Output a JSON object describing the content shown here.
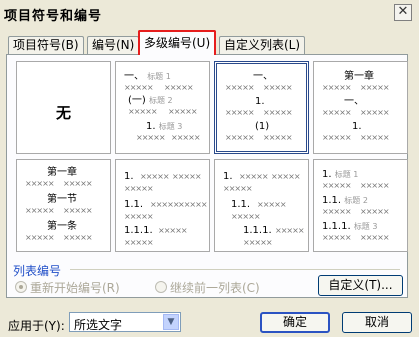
{
  "window": {
    "title": "项目符号和编号",
    "close_glyph": "✕"
  },
  "tabs": [
    {
      "label": "项目符号(B)"
    },
    {
      "label": "编号(N)"
    },
    {
      "label": "多级编号(U)"
    },
    {
      "label": "自定义列表(L)"
    }
  ],
  "active_tab": 2,
  "gallery": {
    "selected_index": 2,
    "x_chars": "×××××",
    "cells": [
      {
        "none_label": "无"
      },
      {
        "lines": [
          {
            "text": "一、",
            "sub": "标题 1"
          },
          {
            "text": "(一)",
            "sub": "标题 2"
          },
          {
            "text": "1.",
            "sub": "标题 3"
          }
        ]
      },
      {
        "lines": [
          {
            "text": "一、"
          },
          {
            "text": "1."
          },
          {
            "text": "(1)"
          }
        ]
      },
      {
        "lines": [
          {
            "text": "第一章"
          },
          {
            "text": "一、"
          },
          {
            "text": "1."
          }
        ]
      },
      {
        "lines": [
          {
            "text": "第一章"
          },
          {
            "text": "第一节"
          },
          {
            "text": "第一条"
          }
        ]
      },
      {
        "lines": [
          {
            "text": "1."
          },
          {
            "text": "1.1."
          },
          {
            "text": "1.1.1."
          }
        ]
      },
      {
        "lines": [
          {
            "text": "1."
          },
          {
            "text": "1.1."
          },
          {
            "text": "1.1.1."
          }
        ]
      },
      {
        "lines": [
          {
            "text": "1.",
            "sub": "标题 1"
          },
          {
            "text": "1.1.",
            "sub": "标题 2"
          },
          {
            "text": "1.1.1.",
            "sub": "标题 3"
          }
        ]
      }
    ]
  },
  "list_numbering": {
    "title": "列表编号",
    "restart_label": "重新开始编号(R)",
    "continue_label": "继续前一列表(C)",
    "customize_button": "自定义(T)..."
  },
  "footer": {
    "apply_label": "应用于(Y):",
    "apply_value": "所选文字",
    "ok_button": "确定",
    "cancel_button": "取消"
  }
}
